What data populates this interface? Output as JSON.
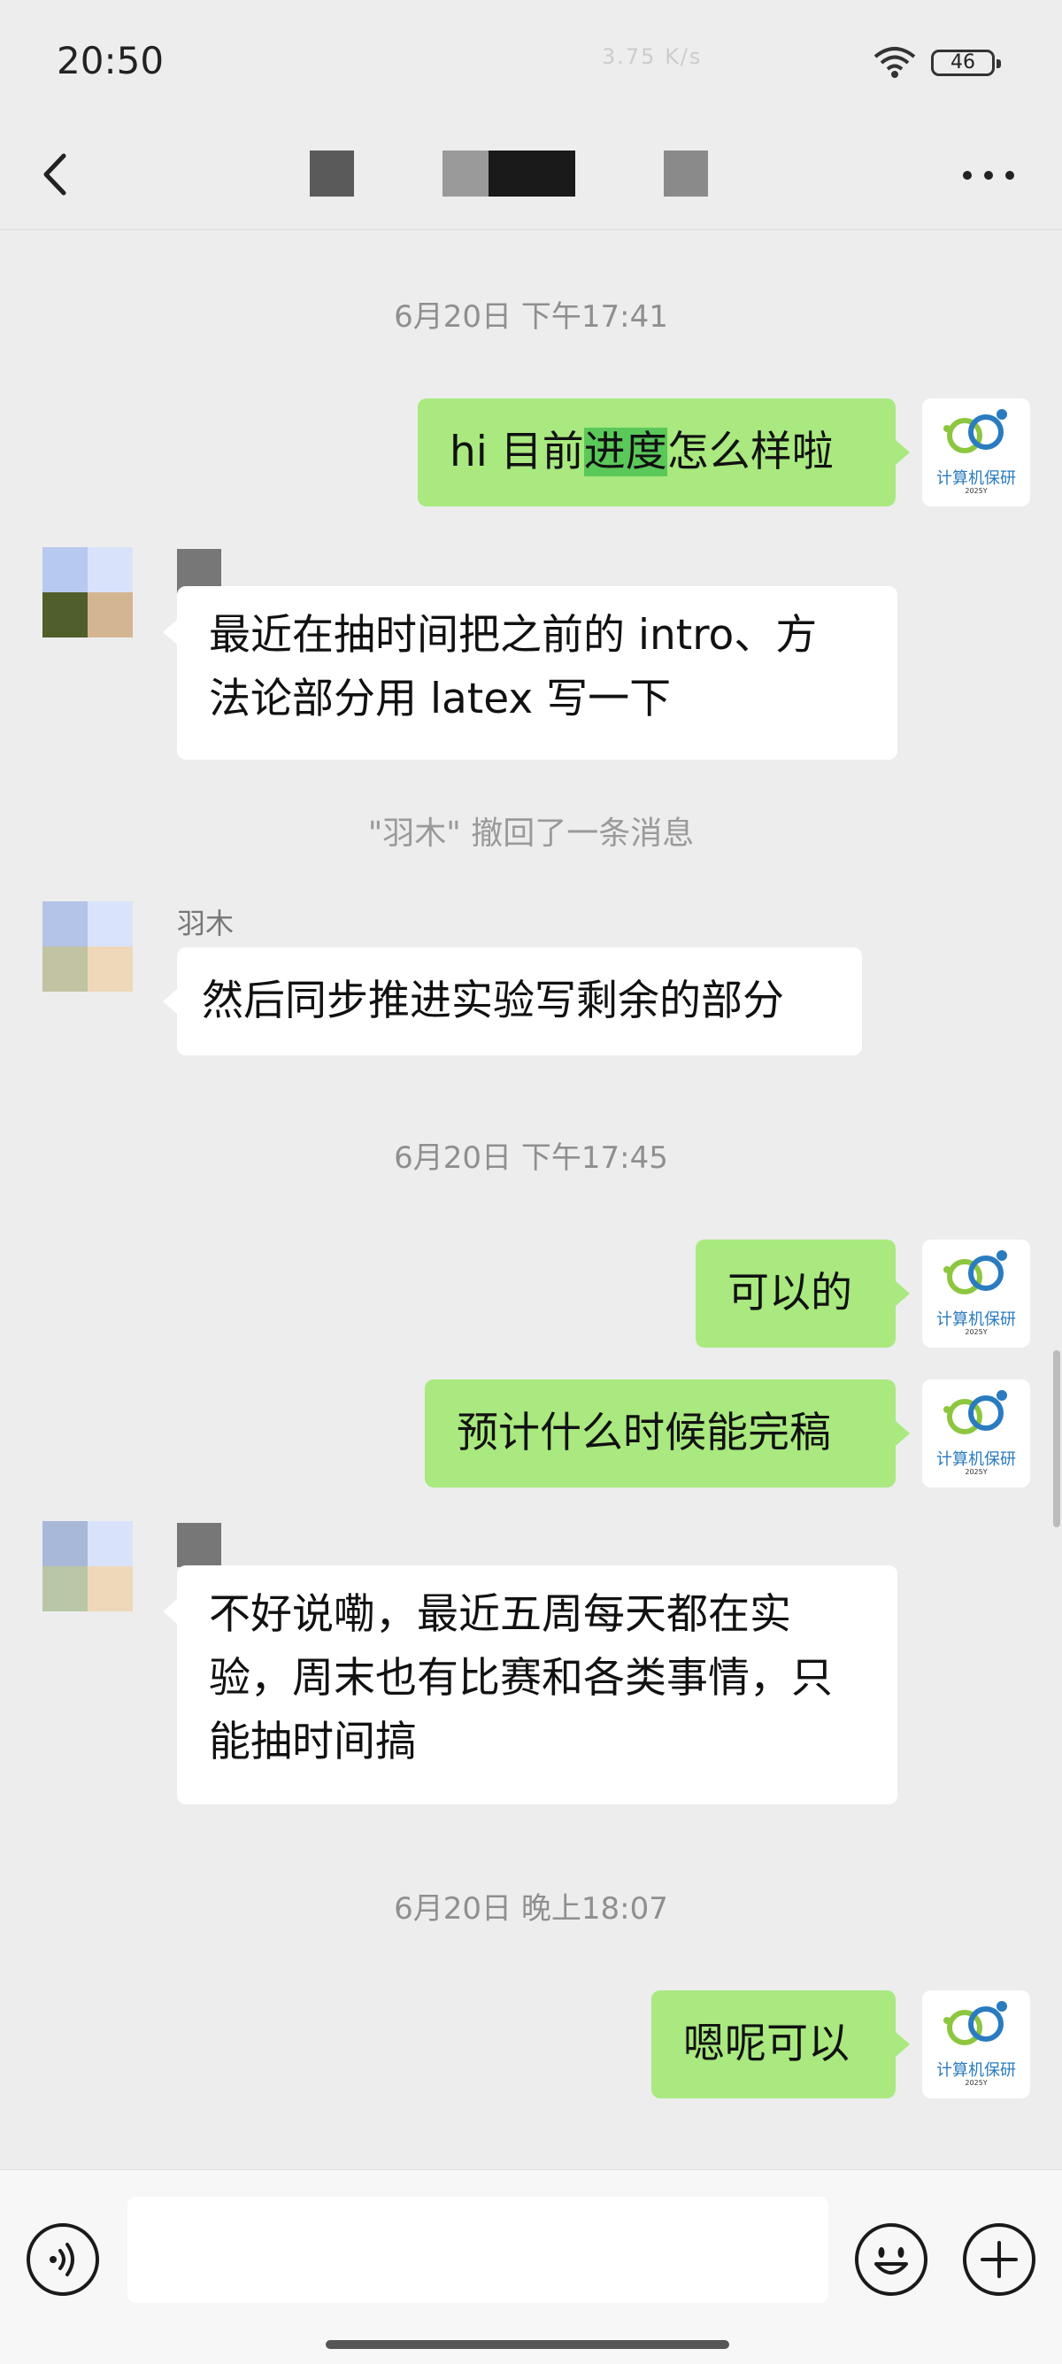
{
  "status_bar": {
    "time": "20:50",
    "network_speed": "3.75 K/s",
    "battery": "46"
  },
  "header": {
    "title": ""
  },
  "colors": {
    "my_bubble": "#a9e97f",
    "other_bubble": "#ffffff",
    "background": "#ededed",
    "timestamp_text": "#8f8f8f"
  },
  "my_avatar": {
    "caption": "计算机保研",
    "small_text": "2025Y"
  },
  "messages": {
    "ts1": "6月20日 下午17:41",
    "m1_pre": "hi 目前",
    "m1_hl": "进度",
    "m1_post": "怎么样啦",
    "m2_line1": "最近在抽时间把之前的 intro、方",
    "m2_line2": "法论部分用 latex 写一下",
    "recall": "\"羽木\" 撤回了一条消息",
    "sender_name": "羽木",
    "m3": "然后同步推进实验写剩余的部分",
    "ts2": "6月20日 下午17:45",
    "m4": "可以的",
    "m5": "预计什么时候能完稿",
    "m6_line1": "不好说嘞，最近五周每天都在实",
    "m6_line2": "验，周末也有比赛和各类事情，只",
    "m6_line3": "能抽时间搞",
    "ts3": "6月20日 晚上18:07",
    "m7": "嗯呢可以"
  },
  "icons": {
    "back": "back-arrow-icon",
    "more": "more-dots-icon",
    "voice": "voice-icon",
    "emoji": "emoji-icon",
    "plus": "plus-icon",
    "wifi": "wifi-icon"
  },
  "input": {
    "placeholder": ""
  }
}
